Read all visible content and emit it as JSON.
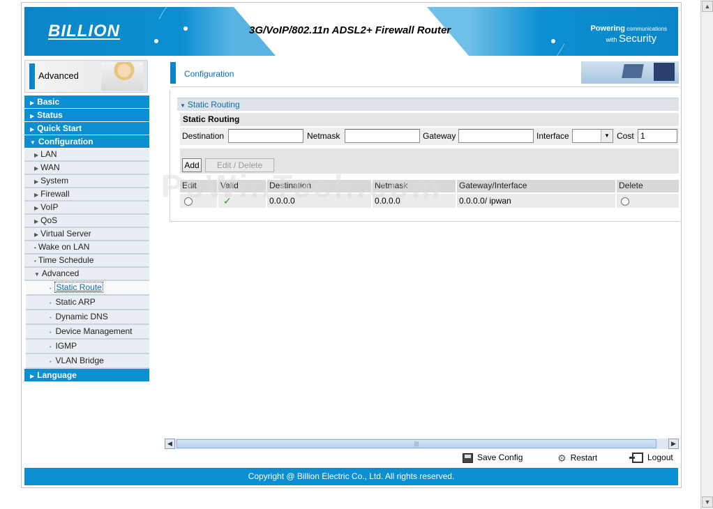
{
  "header": {
    "logo": "BILLION",
    "title": "3G/VoIP/802.11n ADSL2+ Firewall Router",
    "tagline_line1_a": "Powering",
    "tagline_line1_b": " communications",
    "tagline_line2_a": "with ",
    "tagline_line2_b": "Security"
  },
  "nav": {
    "banner": "Advanced",
    "top_items": [
      "Basic",
      "Status",
      "Quick Start",
      "Configuration"
    ],
    "config_items": [
      "LAN",
      "WAN",
      "System",
      "Firewall",
      "VoIP",
      "QoS",
      "Virtual Server",
      "Wake on LAN",
      "Time Schedule",
      "Advanced"
    ],
    "advanced_items": [
      "Static Route",
      "Static ARP",
      "Dynamic DNS",
      "Device Management",
      "IGMP",
      "VLAN Bridge"
    ],
    "language": "Language"
  },
  "content": {
    "heading": "Configuration",
    "section_title": "Static Routing",
    "box_title": "Static Routing",
    "form": {
      "destination_label": "Destination",
      "destination_value": "",
      "netmask_label": "Netmask",
      "netmask_value": "",
      "gateway_label": "Gateway",
      "gateway_value": "",
      "interface_label": "Interface",
      "interface_value": "",
      "cost_label": "Cost",
      "cost_value": "1"
    },
    "buttons": {
      "add": "Add",
      "edit_delete": "Edit / Delete"
    },
    "table": {
      "headers": [
        "Edit",
        "Valid",
        "Destination",
        "Netmask",
        "Gateway/Interface",
        "Delete"
      ],
      "rows": [
        {
          "destination": "0.0.0.0",
          "netmask": "0.0.0.0",
          "gateway_interface": "0.0.0.0/ ipwan"
        }
      ]
    }
  },
  "actions": {
    "save": "Save Config",
    "restart": "Restart",
    "logout": "Logout"
  },
  "footer": "Copyright @ Billion Electric Co., Ltd. All rights reserved.",
  "watermark": "PcWinTech.com",
  "colors": {
    "brand_blue": "#0b8fd2",
    "link_blue": "#0b6bb0",
    "valid_green": "#1a9a22"
  }
}
